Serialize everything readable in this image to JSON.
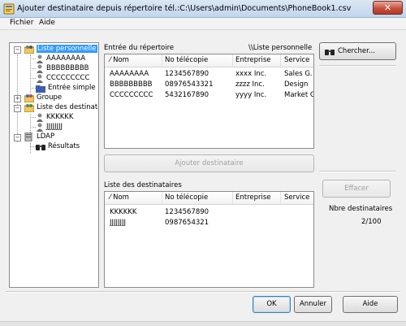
{
  "window": {
    "title": "Ajouter destinataire depuis répertoire tél.:C:\\Users\\admin\\Documents\\PhoneBook1.csv",
    "close_glyph": "✕"
  },
  "menu": [
    "Fichier",
    "Aide"
  ],
  "tree": {
    "personal_list": "Liste personnelle",
    "personal_items": [
      "AAAAAAAA",
      "BBBBBBBBB",
      "CCCCCCCCC"
    ],
    "single_entry": "Entrée simple",
    "group": "Groupe",
    "dest_lists": "Liste des destinataires",
    "dest_items": [
      "KKKKKK",
      "JJJJJJJJ"
    ],
    "ldap": "LDAP",
    "results": "Résultats"
  },
  "directory": {
    "label": "Entrée du répertoire",
    "source": "\\\\Liste personnelle",
    "columns": [
      "Nom",
      "No télécopie",
      "Entreprise",
      "Service"
    ],
    "rows": [
      [
        "AAAAAAAA",
        "1234567890",
        "xxxx Inc.",
        "Sales G."
      ],
      [
        "BBBBBBBBB",
        "08976543321",
        "zzzz Inc.",
        "Design"
      ],
      [
        "CCCCCCCCC",
        "5432167890",
        "yyyy Inc.",
        "Market G."
      ]
    ]
  },
  "add_button": "Ajouter destinataire",
  "recipients": {
    "label": "Liste des destinataires",
    "columns": [
      "Nom",
      "No télécopie",
      "Entreprise",
      "Service"
    ],
    "rows": [
      [
        "KKKKKK",
        "1234567890"
      ],
      [
        "JJJJJJJJ",
        "0987654321"
      ]
    ]
  },
  "right": {
    "search_button": "Chercher...",
    "clear_button": "Effacer",
    "count_label": "Nbre destinataires",
    "count_value": "2/100"
  },
  "footer": {
    "ok": "OK",
    "cancel": "Annuler",
    "help": "Aide"
  },
  "colors": {
    "selection": "#3399ff",
    "title_gradient": "#c2d5ec",
    "close_red": "#c7503c"
  },
  "icons": {
    "app": "phonebook-icon",
    "search": "binoculars-icon",
    "person": "person-icon",
    "folder": "folder-icon",
    "group": "group-icon",
    "server": "server-icon"
  }
}
